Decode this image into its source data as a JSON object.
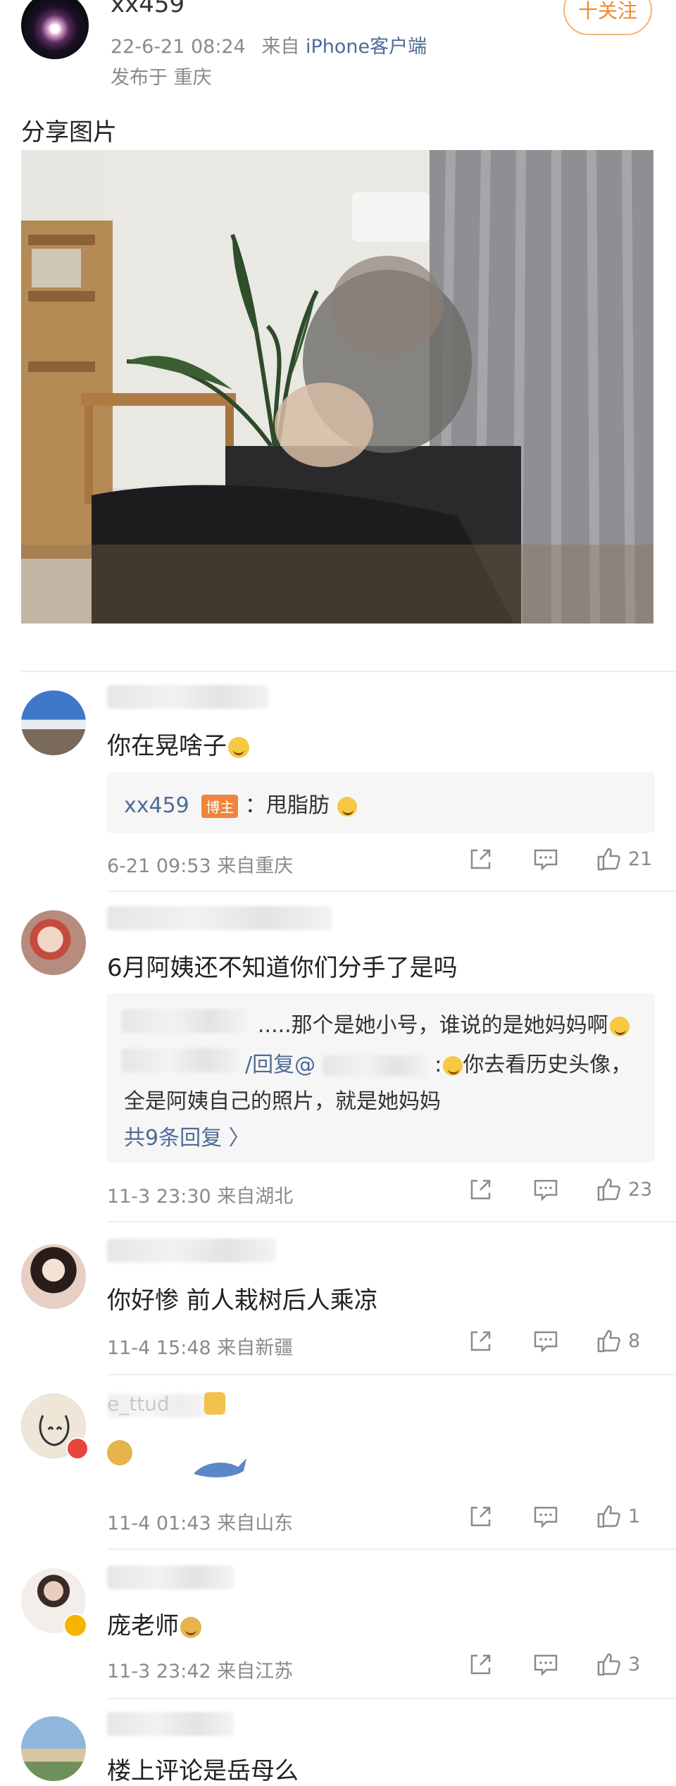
{
  "post": {
    "username": "xx459",
    "follow_label": "十关注",
    "time": "22-6-21 08:24",
    "source_prefix": "来自",
    "source_device": "iPhone客户端",
    "location": "发布于 重庆",
    "text": "分享图片"
  },
  "comments": [
    {
      "text": "你在晃啥子",
      "reply": {
        "user": "xx459",
        "badge": "博主",
        "text": "：甩脂肪"
      },
      "meta": "6-21 09:53  来自重庆",
      "likes": "21"
    },
    {
      "text": "6月阿姨还不知道你们分手了是吗",
      "reply_lines": [
        ".....那个是她小号，谁说的是她妈妈啊",
        "/回复@",
        "你去看历史头像，",
        "全是阿姨自己的照片，就是她妈妈"
      ],
      "more": "共9条回复 〉",
      "meta": "11-3 23:30  来自湖北",
      "likes": "23"
    },
    {
      "text": "你好惨 前人栽树后人乘凉",
      "meta": "11-4 15:48  来自新疆",
      "likes": "8"
    },
    {
      "name_partial": "e_ttud",
      "meta": "11-4 01:43  来自山东",
      "likes": "1"
    },
    {
      "text": "庞老师",
      "meta": "11-3 23:42  来自江苏",
      "likes": "3"
    },
    {
      "text": "楼上评论是岳母么"
    }
  ],
  "icons": {
    "share": "share-icon",
    "comment": "comment-icon",
    "like": "like-icon"
  },
  "colors": {
    "link_blue": "#4f6b96",
    "follow_orange": "#f08a2c",
    "badge_orange": "#f0843a"
  }
}
